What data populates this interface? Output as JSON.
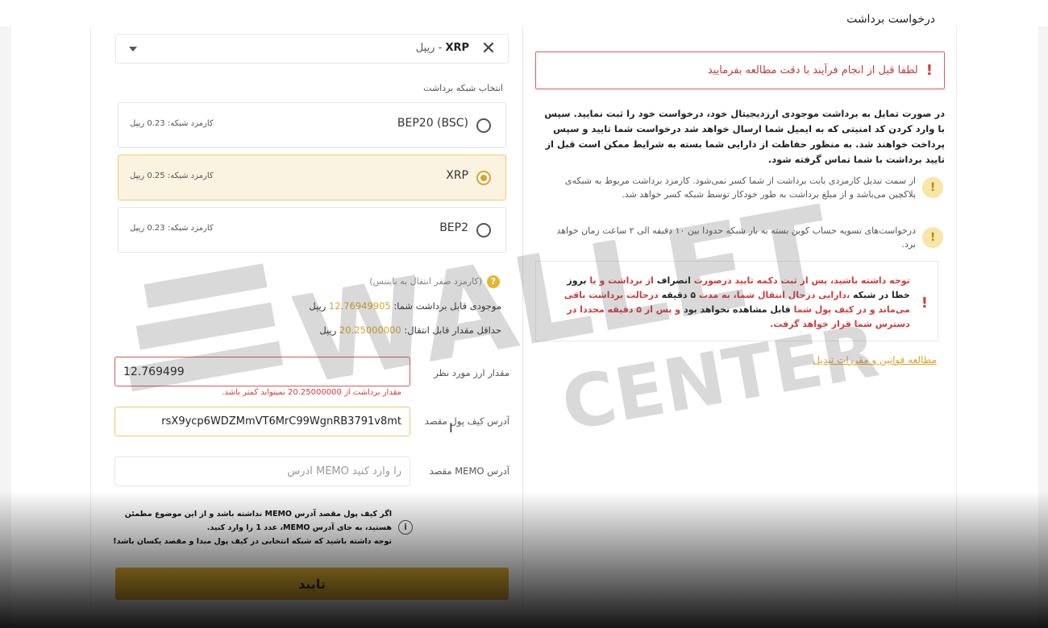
{
  "right": {
    "title": "درخواست برداشت",
    "warning": "لطفا قبل از انجام فرآیند با دقت مطالعه بفرمایید",
    "paragraph": "در صورت تمایل به برداشت موجودی ارزدیجیتال خود، درخواست خود را ثبت نمایید. سپس با وارد کردن کد امنیتی که به ایمیل شما ارسال خواهد شد درخواست شما تایید و سپس پرداخت خواهند شد. به منظور حفاظت از دارایی شما بسته به شرایط ممکن است قبل از تایید برداشت با شما تماس گرفته شود.",
    "tip1": "از سمت تبدیل کارمزدی بابت برداشت از شما کسر نمی‌شود. کارمزد برداشت مربوط به شبکه‌ی بلاکچین می‌باشد و از مبلغ برداشت به طور خودکار توسط شبکه کسر خواهد شد.",
    "tip2": "درخواست‌های تسویه حساب کوین بسته به بار شبکه حدودا بین ۱۰ دقیقه الی ۲ ساعت زمان خواهد برد.",
    "notice": {
      "p1": "توجه داشته باشید، پس از ثبت دکمه تایید درصورت",
      "b1": "انصراف",
      "p2": "از برداشت و یا",
      "b2": "بروز خطا در شبکه",
      "p3": "،دارایی درحال انتقال شما، به مدت",
      "b3": "۵ دقیقه",
      "p4": "درحالت برداشت باقی می‌ماند و در کیف پول شما",
      "b4": "قابل مشاهده نخواهد بود",
      "p5": "و پس از ۵ دقیقه مجددا در دسترس شما قرار خواهد گرفت."
    },
    "rules_link": "مطالعه قوانین و مقررات تبدیل"
  },
  "left": {
    "currency": {
      "code": "XRP",
      "name": "- ریپل"
    },
    "network_label": "انتخاب شبکه برداشت",
    "networks": [
      {
        "name": "BEP20 (BSC)",
        "fee": "کارمزد شبکه: 0.23 ریپل",
        "selected": false
      },
      {
        "name": "XRP",
        "fee": "کارمزد شبکه: 0.25 ریپل",
        "selected": true
      },
      {
        "name": "BEP2",
        "fee": "کارمزد شبکه: 0.23 ریپل",
        "selected": false
      }
    ],
    "zero_fee": "(کارمزد صفر انتقال به بایننس)",
    "balance_label": "موجودی قابل برداشت شما:",
    "balance_value": "12.76949905",
    "balance_unit": "ریپل",
    "min_label": "حداقل مقدار قابل انتقال:",
    "min_value": "20.25000000",
    "min_unit": "ریپل",
    "amount_label": "مقدار ارز مورد نظر",
    "amount_value": "12.769499",
    "amount_error": "مقدار برداشت از 20.25000000 نمیتواند کمتر باشد.",
    "address_label": "آدرس کیف پول مقصد",
    "address_value": "rsX9ycp6WDZMmVT6MrC99WgnRB3791v8mt",
    "memo_label": "آدرس MEMO مقصد",
    "memo_placeholder": "را وارد کنید MEMO آدرس",
    "memo_note_1": "اگر کیف پول مقصد آدرس MEMO نداشته باشد و از این موضوع مطمئن هستید، به جای آدرس MEMO، عدد 1 را وارد کنید.",
    "memo_note_2": "توجه داشته باشید که شبکه انتخابی در کیف پول مبدا و مقصد یکسان باشد!",
    "confirm_label": "تایید"
  },
  "watermark": {
    "line1": "WALLET",
    "line2": "CENTER"
  }
}
